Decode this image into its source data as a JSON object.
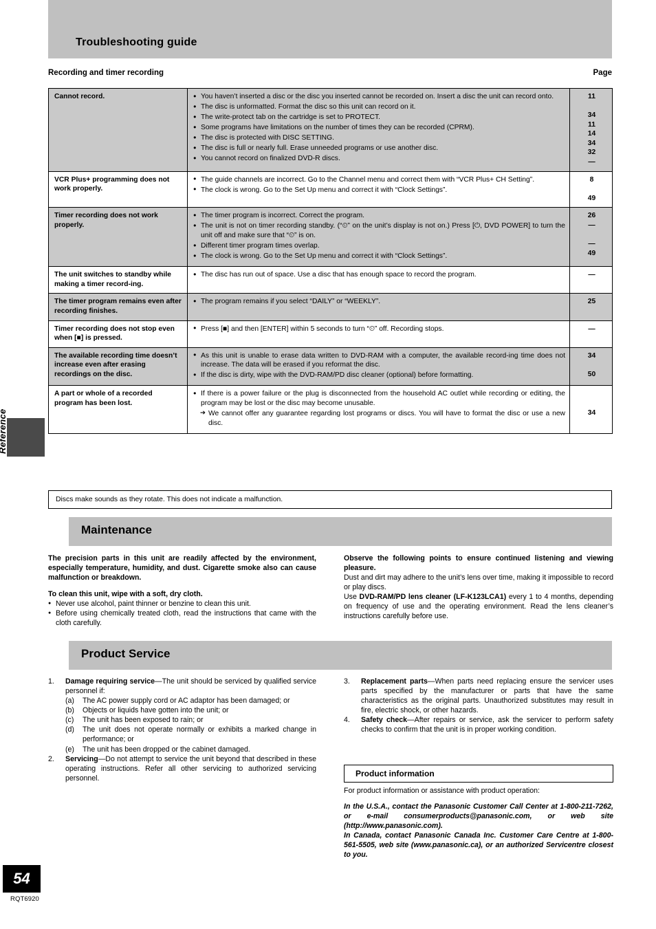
{
  "banner": {
    "title": "Troubleshooting guide"
  },
  "section": {
    "label": "Recording and timer recording",
    "page_col": "Page"
  },
  "table": {
    "rows": [
      {
        "symptom": "Cannot record.",
        "items": [
          {
            "text": "You haven’t inserted a disc or the disc you inserted cannot be recorded on. Insert a disc the unit can record onto.",
            "page": "11",
            "lines": 2
          },
          {
            "text": "The disc is unformatted. Format the disc so this unit can record on it.",
            "page": "34",
            "lines": 1
          },
          {
            "text": "The write-protect tab on the cartridge is set to PROTECT.",
            "page": "11",
            "lines": 1
          },
          {
            "text": "Some programs have limitations on the number of times they can be recorded (CPRM).",
            "page": "14",
            "lines": 1
          },
          {
            "text": "The disc is protected with DISC SETTING.",
            "page": "34",
            "lines": 1
          },
          {
            "text": "The disc is full or nearly full. Erase unneeded programs or use another disc.",
            "page": "32",
            "lines": 1
          },
          {
            "text": "You cannot record on finalized DVD-R discs.",
            "page": "—",
            "lines": 1
          }
        ]
      },
      {
        "symptom": "VCR Plus+ programming does not work properly.",
        "items": [
          {
            "text": "The guide channels are incorrect. Go to the Channel menu and correct them with “VCR Plus+ CH Setting”.",
            "page": "8",
            "lines": 2
          },
          {
            "text": "The clock is wrong. Go to the Set Up menu and correct it with “Clock Settings”.",
            "page": "49",
            "lines": 1
          }
        ]
      },
      {
        "symptom": "Timer recording does not work properly.",
        "items": [
          {
            "text": "The timer program is incorrect. Correct the program.",
            "page": "26",
            "lines": 1
          },
          {
            "text": "The unit is not on timer recording standby. (“⏲” on the unit’s display is not on.) Press [⏻, DVD POWER] to turn the unit off and make sure that “⏲” is on.",
            "page": "—",
            "lines": 2
          },
          {
            "text": "Different timer program times overlap.",
            "page": "—",
            "lines": 1
          },
          {
            "text": "The clock is wrong. Go to the Set Up menu and correct it with “Clock Settings”.",
            "page": "49",
            "lines": 1
          }
        ]
      },
      {
        "symptom": "The unit switches to standby while making a timer record-ing.",
        "items": [
          {
            "text": "The disc has run out of space. Use a disc that has enough space to record the program.",
            "page": "—",
            "lines": 1
          }
        ]
      },
      {
        "symptom": "The timer program remains even after recording finishes.",
        "items": [
          {
            "text": "The program remains if you select “DAILY” or “WEEKLY”.",
            "page": "25",
            "lines": 1
          }
        ]
      },
      {
        "symptom": "Timer recording does not stop even when [■] is pressed.",
        "items": [
          {
            "text": "Press [■] and then [ENTER] within 5 seconds to turn “⏲” off. Recording stops.",
            "page": "—",
            "lines": 1
          }
        ]
      },
      {
        "symptom": "The available recording time doesn’t increase even after erasing recordings on the disc.",
        "items": [
          {
            "text": "As this unit is unable to erase data written to DVD-RAM with a computer, the available record-ing time does not increase. The data will be erased if you reformat the disc.",
            "page": "34",
            "lines": 2
          },
          {
            "text": "If the disc is dirty, wipe with the DVD-RAM/PD disc cleaner (optional) before formatting.",
            "page": "50",
            "lines": 1
          }
        ]
      },
      {
        "symptom": "A part or whole of a recorded program has been lost.",
        "items": [
          {
            "text": "If there is a power failure or the plug is disconnected from the household AC outlet while recording or editing, the program may be lost or the disc may become unusable.",
            "page": "",
            "lines": 2
          },
          {
            "text": "We cannot offer any guarantee regarding lost programs or discs. You will have to format the disc or use a new disc.",
            "page": "34",
            "lines": 2,
            "arrow": true
          }
        ]
      }
    ]
  },
  "note": {
    "text": "Discs make sounds as they rotate. This does not indicate a malfunction."
  },
  "maintenance": {
    "heading": "Maintenance",
    "left": {
      "p1": "The precision parts in this unit are readily affected by the environment, especially temperature, humidity, and dust. Cigarette smoke also can cause malfunction or breakdown.",
      "p2": "To clean this unit, wipe with a soft, dry cloth.",
      "bullets": [
        "Never use alcohol, paint thinner or benzine to clean this unit.",
        "Before using chemically treated cloth, read the instructions that came with the cloth carefully."
      ]
    },
    "right": {
      "p1": "Observe the following points to ensure continued listening and viewing pleasure.",
      "p2": "Dust and dirt may adhere to the unit’s lens over time, making it impossible to record or play discs.",
      "p3_pre": "Use ",
      "p3_bold": "DVD-RAM/PD lens cleaner (LF-K123LCA1)",
      "p3_post": " every 1 to 4 months, depending on frequency of use and the operating environment. Read the lens cleaner’s instructions carefully before use."
    }
  },
  "product_service": {
    "heading": "Product Service",
    "items": [
      {
        "num": "1.",
        "bold": "Damage requiring service",
        "text": "—The unit should be serviced by qualified service personnel if:",
        "subs": [
          {
            "lbl": "(a)",
            "text": "The AC power supply cord or AC adaptor has been damaged; or"
          },
          {
            "lbl": "(b)",
            "text": "Objects or liquids have gotten into the unit; or"
          },
          {
            "lbl": "(c)",
            "text": "The unit has been exposed to rain; or"
          },
          {
            "lbl": "(d)",
            "text": "The unit does not operate normally or exhibits a marked change in performance; or"
          },
          {
            "lbl": "(e)",
            "text": "The unit has been dropped or the cabinet damaged."
          }
        ]
      },
      {
        "num": "2.",
        "bold": "Servicing",
        "text": "—Do not attempt to service the unit beyond that described in these operating instructions. Refer all other servicing to authorized servicing personnel.",
        "subs": []
      },
      {
        "num": "3.",
        "bold": "Replacement parts",
        "text": "—When parts need replacing ensure the servicer uses parts specified by the manufacturer or parts that have the same characteristics as the original parts. Unauthorized substitutes may result in fire, electric shock, or other hazards.",
        "subs": []
      },
      {
        "num": "4.",
        "bold": "Safety check",
        "text": "—After repairs or service, ask the servicer to perform safety checks to confirm that the unit is in proper working condition.",
        "subs": []
      }
    ]
  },
  "product_information": {
    "title": "Product information",
    "intro": "For product information or assistance with product operation:",
    "usa": "In the U.S.A., contact the Panasonic Customer Call Center at 1-800-211-7262, or e-mail consumerproducts@panasonic.com, or web site (http://www.panasonic.com).",
    "canada": "In Canada, contact Panasonic Canada Inc. Customer Care Centre at 1-800-561-5505, web site (www.panasonic.ca), or an authorized Servicentre closest to you."
  },
  "furniture": {
    "side_label": "Reference",
    "page_number": "54",
    "doc_code": "RQT6920"
  },
  "colors": {
    "banner_gray": "#c0c0c0",
    "row_gray": "#c9c9c9",
    "tab_dark": "#4a4a4a"
  }
}
